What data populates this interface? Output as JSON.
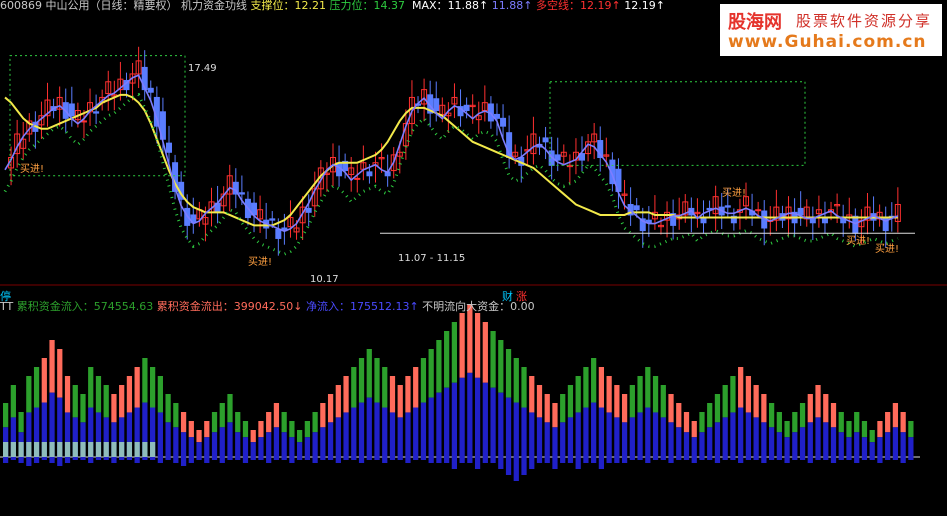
{
  "header": {
    "code": "600869",
    "title": "中山公用（日线：精要权）",
    "indicator": "机力资金功线",
    "support_label": "支撑位：",
    "support": "12.21",
    "pressure_label": "压力位：",
    "pressure": "14.37",
    "max_label": "MAX：",
    "max1": "11.88↑",
    "max2": "11.88↑",
    "multi_label": "多空线：",
    "multi1": "12.19↑",
    "multi2": "12.19↑"
  },
  "watermark": {
    "brand": "股海网",
    "slogan": "股票软件资源分享",
    "url": "www.Guhai.com.cn"
  },
  "price_panel": {
    "annotations": {
      "high": "17.49",
      "low": "10.17",
      "range": "11.07 - 11.15",
      "buy": "买进!"
    },
    "colors": {
      "yellow_ma": "#f2e94a",
      "blue_ma": "#7d7dff",
      "red_ma": "#ff3030",
      "green_dots": "#2ecc40",
      "white_ma": "#ffffff",
      "bull_candle": "#ff3030",
      "bear_candle": "#5a7dff",
      "signal_box": "#ffd700"
    }
  },
  "flow_panel": {
    "tag_left": "停",
    "tag_mid1": "财",
    "tag_mid2": "涨",
    "prefix": "TT",
    "inflow_label": "累积资金流入：",
    "inflow": "574554.63",
    "outflow_label": "累积资金流出：",
    "outflow": "399042.50↓",
    "net_label": "净流入：",
    "net": "175512.13↑",
    "unknown_label": "不明流向大资金：",
    "unknown": "0.00",
    "colors": {
      "inflow": "#2ca02c",
      "outflow": "#ff6b5b",
      "net": "#2020c8",
      "unknown": "#8fbcbc"
    }
  },
  "chart_data": [
    {
      "type": "line",
      "title": "",
      "x": [
        0,
        1,
        2,
        3,
        4,
        5,
        6,
        7,
        8,
        9,
        10,
        11,
        12,
        13,
        14,
        15,
        16,
        17,
        18,
        19,
        20,
        21,
        22,
        23,
        24,
        25,
        26,
        27,
        28,
        29,
        30,
        31,
        32,
        33,
        34,
        35,
        36,
        37,
        38,
        39,
        40,
        41,
        42,
        43,
        44,
        45,
        46,
        47,
        48,
        49,
        50,
        51,
        52,
        53,
        54,
        55,
        56,
        57,
        58,
        59,
        60,
        61,
        62,
        63,
        64,
        65,
        66,
        67,
        68,
        69,
        70,
        71,
        72,
        73,
        74,
        75,
        76,
        77,
        78,
        79,
        80,
        81,
        82,
        83,
        84,
        85,
        86,
        87,
        88,
        89,
        90,
        91,
        92,
        93,
        94,
        95,
        96,
        97,
        98,
        99,
        100,
        101,
        102,
        103,
        104,
        105,
        106,
        107,
        108,
        109,
        110,
        111,
        112,
        113,
        114,
        115,
        116,
        117,
        118,
        119,
        120,
        121,
        122,
        123,
        124,
        125,
        126,
        127,
        128,
        129,
        130,
        131,
        132,
        133,
        134,
        135,
        136,
        137,
        138,
        139,
        140,
        141,
        142,
        143,
        144,
        145,
        146,
        147,
        148,
        149
      ],
      "ylim": [
        9.5,
        18.5
      ],
      "series": [
        {
          "values": [
            13.6,
            14.0,
            14.5,
            14.9,
            15.2,
            15.4,
            15.6,
            15.8,
            16.0,
            16.1,
            15.9,
            15.6,
            15.4,
            15.6,
            15.9,
            16.1,
            16.3,
            16.5,
            16.6,
            16.8,
            17.0,
            17.2,
            17.3,
            16.8,
            16.3,
            15.6,
            14.7,
            13.8,
            12.9,
            12.2,
            11.8,
            11.5,
            11.6,
            11.9,
            12.1,
            12.3,
            12.6,
            12.9,
            12.8,
            12.4,
            12.1,
            11.8,
            11.6,
            11.5,
            11.4,
            11.3,
            11.2,
            11.3,
            11.5,
            11.9,
            12.3,
            12.8,
            13.2,
            13.6,
            13.8,
            13.7,
            13.5,
            13.2,
            13.4,
            13.6,
            13.7,
            13.8,
            13.6,
            13.5,
            13.9,
            14.6,
            15.3,
            15.9,
            16.2,
            16.4,
            16.1,
            15.8,
            15.6,
            15.9,
            16.1,
            16.0,
            15.8,
            15.6,
            15.8,
            15.9,
            15.8,
            15.5,
            14.8,
            14.2,
            14.0,
            14.1,
            14.3,
            14.5,
            14.6,
            14.4,
            14.1,
            13.9,
            13.8,
            13.9,
            14.0,
            14.3,
            14.6,
            14.5,
            14.2,
            13.9,
            13.4,
            12.7,
            12.2,
            12.0,
            11.8,
            11.6,
            11.5,
            11.5,
            11.6,
            11.7,
            11.8,
            11.8,
            11.9,
            12.0,
            11.7,
            11.9,
            12.0,
            12.1,
            12.0,
            11.9,
            11.9,
            12.0,
            12.1,
            12.0,
            11.8,
            11.7,
            11.6,
            11.7,
            11.8,
            11.9,
            11.9,
            11.8,
            11.7,
            11.7,
            11.8,
            11.9,
            12.0,
            11.8,
            11.7,
            11.6,
            11.5,
            11.6,
            11.7,
            11.8,
            11.7,
            11.6,
            11.7,
            11.8
          ]
        },
        {
          "values": [
            16.3,
            16.1,
            15.8,
            15.5,
            15.3,
            15.2,
            15.1,
            15.1,
            15.2,
            15.3,
            15.4,
            15.5,
            15.6,
            15.7,
            15.8,
            15.9,
            16.1,
            16.2,
            16.3,
            16.4,
            16.4,
            16.3,
            16.1,
            15.8,
            15.3,
            14.7,
            14.1,
            13.5,
            13.0,
            12.6,
            12.3,
            12.1,
            12.0,
            11.9,
            11.9,
            11.9,
            11.9,
            11.8,
            11.7,
            11.6,
            11.5,
            11.4,
            11.4,
            11.4,
            11.4,
            11.5,
            11.6,
            11.8,
            12.1,
            12.4,
            12.7,
            13.0,
            13.3,
            13.5,
            13.7,
            13.8,
            13.8,
            13.8,
            13.8,
            13.9,
            14.0,
            14.1,
            14.3,
            14.6,
            15.0,
            15.4,
            15.7,
            15.9,
            15.9,
            15.9,
            15.8,
            15.7,
            15.6,
            15.4,
            15.2,
            15.0,
            14.8,
            14.6,
            14.5,
            14.4,
            14.3,
            14.2,
            14.1,
            14.0,
            13.9,
            13.8,
            13.7,
            13.6,
            13.4,
            13.2,
            13.0,
            12.8,
            12.6,
            12.4,
            12.2,
            12.1,
            12.0,
            11.9,
            11.8,
            11.8,
            11.8,
            11.8,
            11.8,
            11.9,
            11.9,
            11.9,
            11.9,
            11.8,
            11.8,
            11.8,
            11.8,
            11.7,
            11.7,
            11.7,
            11.7,
            11.7,
            11.7,
            11.7,
            11.7,
            11.7,
            11.7,
            11.7,
            11.7,
            11.7,
            11.7,
            11.7,
            11.7,
            11.7,
            11.7,
            11.7,
            11.7,
            11.7,
            11.7,
            11.7,
            11.7,
            11.7,
            11.7,
            11.7,
            11.7,
            11.7,
            11.7,
            11.7,
            11.7,
            11.7,
            11.7,
            11.7,
            11.7,
            11.7
          ]
        }
      ]
    },
    {
      "type": "bar",
      "title": "",
      "categories": [],
      "series": [
        {
          "values": [
            6,
            8,
            5,
            9,
            10,
            11,
            13,
            12,
            9,
            8,
            7,
            10,
            9,
            8,
            7,
            8,
            9,
            10,
            11,
            10,
            9,
            7,
            6,
            5,
            4,
            3,
            4,
            5,
            6,
            7,
            5,
            4,
            3,
            4,
            5,
            6,
            5,
            4,
            3,
            4,
            5,
            6,
            7,
            8,
            9,
            10,
            11,
            12,
            11,
            10,
            9,
            8,
            9,
            10,
            11,
            12,
            13,
            14,
            15,
            16,
            17,
            16,
            15,
            14,
            13,
            12,
            11,
            10,
            9,
            8,
            7,
            6,
            7,
            8,
            9,
            10,
            11,
            10,
            9,
            8,
            7,
            8,
            9,
            10,
            9,
            8,
            7,
            6,
            5,
            4,
            5,
            6,
            7,
            8,
            9,
            10,
            9,
            8,
            7,
            6,
            5,
            4,
            5,
            6,
            7,
            8,
            7,
            6,
            5,
            4,
            5,
            4,
            3,
            4,
            5,
            6,
            5,
            4
          ]
        },
        {
          "values": [
            -2,
            -1,
            -2,
            -3,
            -2,
            -1,
            -2,
            -3,
            -2,
            -1,
            -1,
            -2,
            -1,
            -1,
            -2,
            -1,
            -1,
            -2,
            -1,
            -1,
            -2,
            -1,
            -2,
            -3,
            -2,
            -1,
            -2,
            -1,
            -2,
            -1,
            -1,
            -2,
            -1,
            -1,
            -2,
            -1,
            -1,
            -2,
            -1,
            -1,
            -2,
            -1,
            -1,
            -2,
            -1,
            -1,
            -2,
            -1,
            -1,
            -2,
            -1,
            -1,
            -2,
            -1,
            -1,
            -2,
            -1,
            -1,
            -2,
            -1,
            -1,
            -2,
            -1,
            -1,
            -2,
            -3,
            -4,
            -3,
            -2,
            -1,
            -1,
            -2,
            -1,
            -1,
            -2,
            -1,
            -1,
            -2,
            -1,
            -1,
            -2,
            -1,
            -1,
            -2,
            -1,
            -1,
            -2,
            -1,
            -1,
            -2,
            -1,
            -1,
            -2,
            -1,
            -1,
            -2,
            -1,
            -1,
            -2,
            -1,
            -1,
            -2,
            -1,
            -1,
            -2,
            -1,
            -1,
            -2,
            -1,
            -1,
            -2,
            -1,
            -1,
            -2,
            -1,
            -1,
            -2,
            -1
          ]
        }
      ]
    }
  ]
}
